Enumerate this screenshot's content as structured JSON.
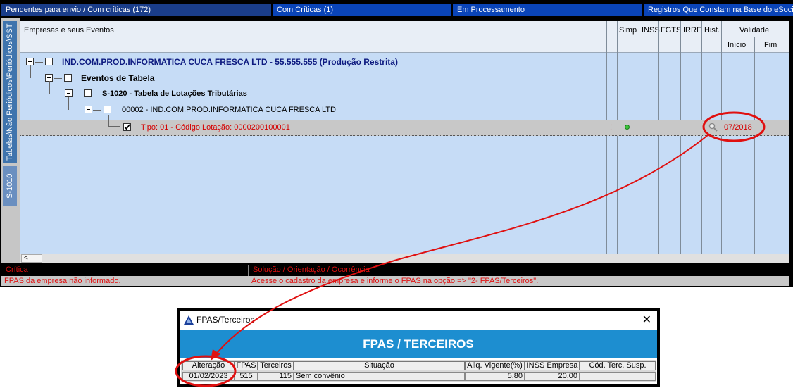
{
  "tabs": [
    {
      "label": "Pendentes para envio / Com críticas (172)"
    },
    {
      "label": "Com Críticas (1)"
    },
    {
      "label": "Em Processamento"
    },
    {
      "label": "Registros Que Constam na Base do eSocial"
    }
  ],
  "side_tabs": [
    {
      "label": "Tabelas\\Não Periódicos\\Periódicos\\SST"
    },
    {
      "label": "S-1010"
    }
  ],
  "grid": {
    "headers": {
      "events": "Empresas e seus Eventos",
      "simp": "Simp",
      "inss": "INSS",
      "fgts": "FGTS",
      "irrf": "IRRF",
      "hist": "Hist.",
      "validade": "Validade",
      "inicio": "Início",
      "fim": "Fim"
    },
    "rows": [
      {
        "label": "IND.COM.PROD.INFORMATICA CUCA FRESCA LTD - 55.555.555 (Produção Restrita)"
      },
      {
        "label": "Eventos de Tabela"
      },
      {
        "label": "S-1020 - Tabela de Lotações Tributárias"
      },
      {
        "label": "00002 - IND.COM.PROD.INFORMATICA CUCA FRESCA LTD"
      },
      {
        "label": "Tipo: 01 - Código Lotação: 0000200100001",
        "flag": "!",
        "inicio": "07/2018",
        "checked": true
      }
    ],
    "scroll_left": "<"
  },
  "messages": {
    "critica_header": "Crítica",
    "solucao_header": "Solução / Orientação / Ocorrência",
    "critica": "FPAS da empresa não informado.",
    "solucao": "Acesse o cadastro da empresa e informe o FPAS na opção => \"2- FPAS/Terceiros\"."
  },
  "dialog": {
    "title": "FPAS/Terceiros",
    "close": "✕",
    "banner": "FPAS / TERCEIROS",
    "columns": [
      "Alteração",
      "FPAS",
      "Terceiros",
      "Situação",
      "Aliq. Vigente(%)",
      "INSS Empresa",
      "Cód. Terc. Susp."
    ],
    "row": {
      "alteracao": "01/02/2023",
      "fpas": "515",
      "terceiros": "115",
      "situacao": "Sem convênio",
      "aliq": "5,80",
      "inss": "20,00",
      "cod": ""
    }
  },
  "colors": {
    "tab_active": "#1a3d8a",
    "tab": "#0a44b8",
    "grid_bg": "#c6dcf6",
    "critical_text": "#d40000",
    "annotation": "#e01010",
    "banner": "#1d8ed0"
  },
  "icons": {
    "status": "green-dot-icon",
    "history": "magnifier-icon",
    "app": "triangle-logo-icon"
  }
}
